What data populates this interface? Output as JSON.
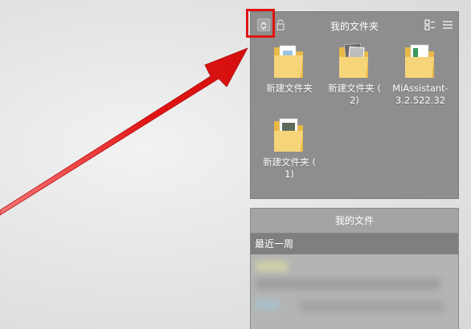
{
  "folder_panel": {
    "title": "我的文件夹",
    "items": [
      {
        "label": "新建文件夹",
        "icon": "folder-icon-blue-doc"
      },
      {
        "label": "新建文件夹 ( 2)",
        "icon": "folder-icon-photo"
      },
      {
        "label": "MiAssistant-3.2.522.32",
        "icon": "folder-icon-installer"
      },
      {
        "label": "新建文件夹 ( 1)",
        "icon": "folder-icon-image"
      }
    ]
  },
  "files_panel": {
    "title": "我的文件",
    "section": "最近一周"
  },
  "colors": {
    "highlight": "#e01414",
    "arrow": "#e01414",
    "panel_bg": "#8e8e8e",
    "folder": "#f2cf6b"
  }
}
